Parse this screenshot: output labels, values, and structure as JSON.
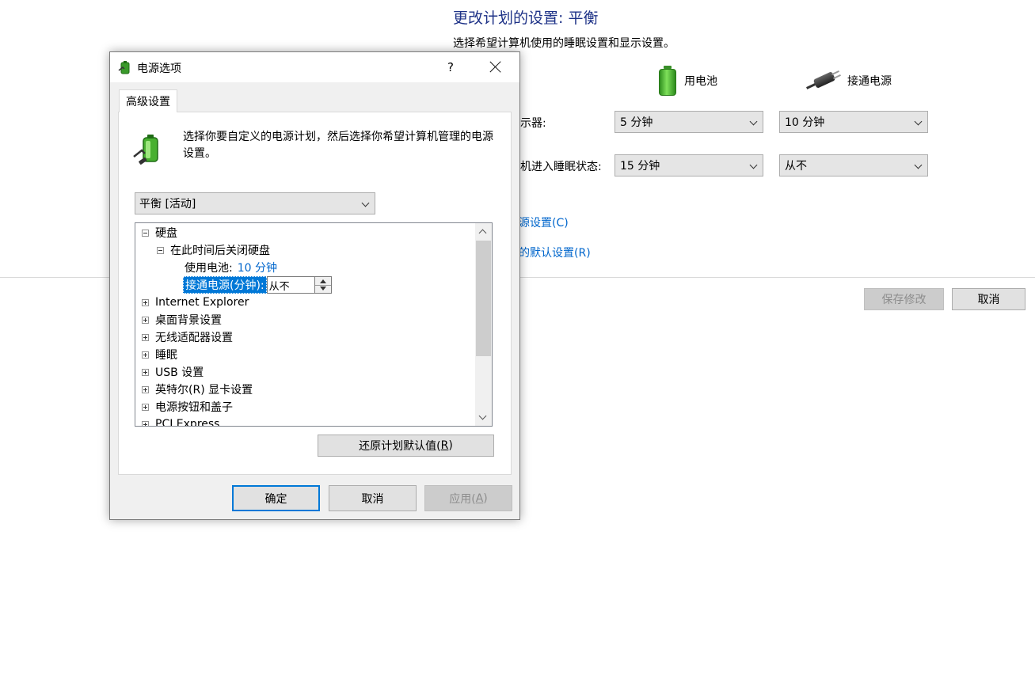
{
  "background": {
    "title": "更改计划的设置: 平衡",
    "subtitle": "选择希望计算机使用的睡眠设置和显示设置。",
    "col_battery": "用电池",
    "col_plugged": "接通电源",
    "row1_label": "示器:",
    "row2_label": "机进入睡眠状态:",
    "row1_battery": "5 分钟",
    "row1_plugged": "10 分钟",
    "row2_battery": "15 分钟",
    "row2_plugged": "从不",
    "link1": "源设置(C)",
    "link2": "的默认设置(R)",
    "save_button": "保存修改",
    "cancel_button": "取消"
  },
  "dialog": {
    "title": "电源选项",
    "help": "?",
    "tab": "高级设置",
    "description": "选择你要自定义的电源计划，然后选择你希望计算机管理的电源设置。",
    "plan_select": "平衡 [活动]",
    "tree": {
      "hard_disk": "硬盘",
      "turn_off_disk": "在此时间后关闭硬盘",
      "on_battery_label": "使用电池:",
      "on_battery_value": "10 分钟",
      "plugged_label": "接通电源(分钟):",
      "plugged_value": "从不",
      "internet_explorer": "Internet Explorer",
      "desktop_background": "桌面背景设置",
      "wireless_adapter": "无线适配器设置",
      "sleep": "睡眠",
      "usb": "USB 设置",
      "intel_graphics": "英特尔(R) 显卡设置",
      "power_buttons": "电源按钮和盖子",
      "pci_express": "PCI Express"
    },
    "restore_prefix": "还原计划默认值(",
    "restore_key": "R",
    "restore_suffix": ")",
    "ok": "确定",
    "cancel": "取消",
    "apply_prefix": "应用(",
    "apply_key": "A",
    "apply_suffix": ")"
  },
  "colors": {
    "title_blue": "#1e3287",
    "link_blue": "#0066cc",
    "selection": "#0078d7"
  }
}
